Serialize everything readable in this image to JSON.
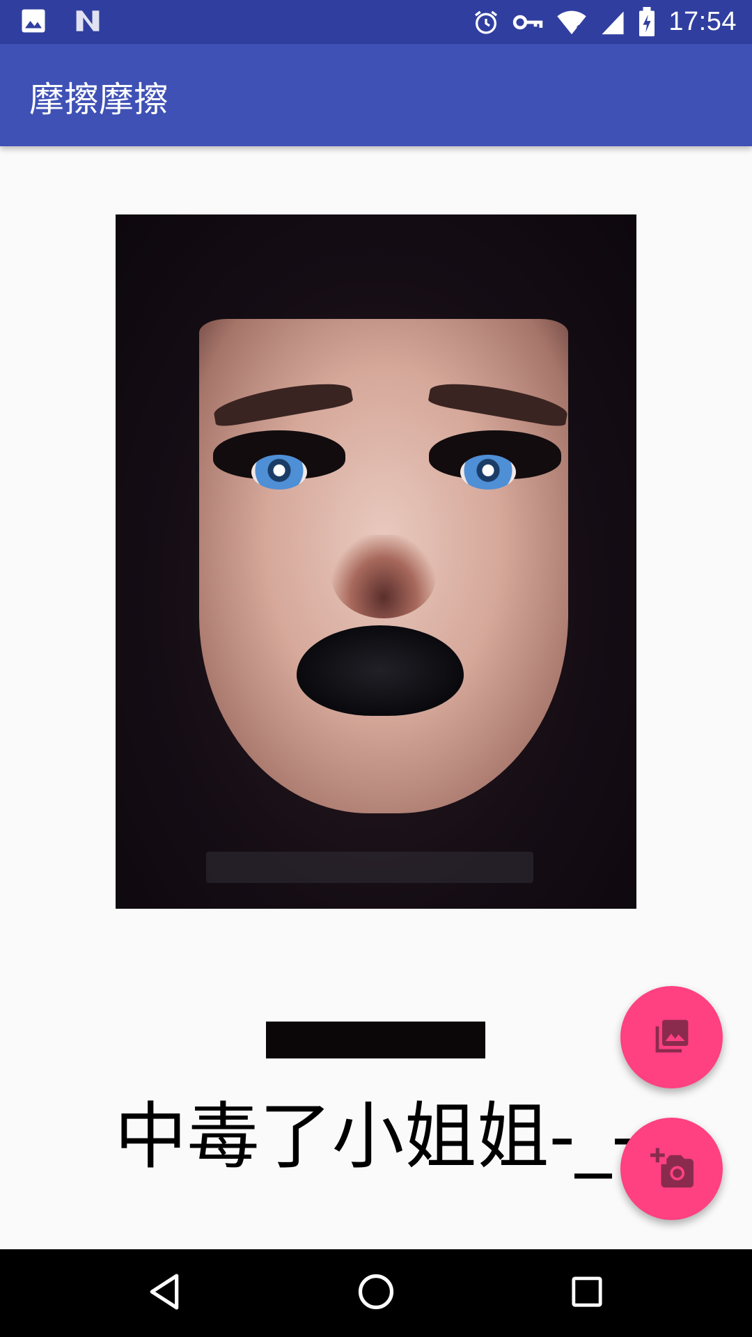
{
  "status_bar": {
    "time": "17:54",
    "left_icons": [
      "image-icon",
      "n-icon"
    ],
    "right_icons": [
      "alarm-icon",
      "key-icon",
      "wifi-icon",
      "signal-icon",
      "battery-charging-icon"
    ],
    "background_color": "#303f9f"
  },
  "app_bar": {
    "title": "摩擦摩擦",
    "background_color": "#3f51b5"
  },
  "main": {
    "caption": "中毒了小姐姐-_-"
  },
  "fabs": {
    "gallery_icon": "photo-library-icon",
    "camera_icon": "add-a-photo-icon",
    "color": "#ff4081"
  },
  "nav_bar": {
    "buttons": [
      "back-icon",
      "home-icon",
      "recents-icon"
    ]
  }
}
